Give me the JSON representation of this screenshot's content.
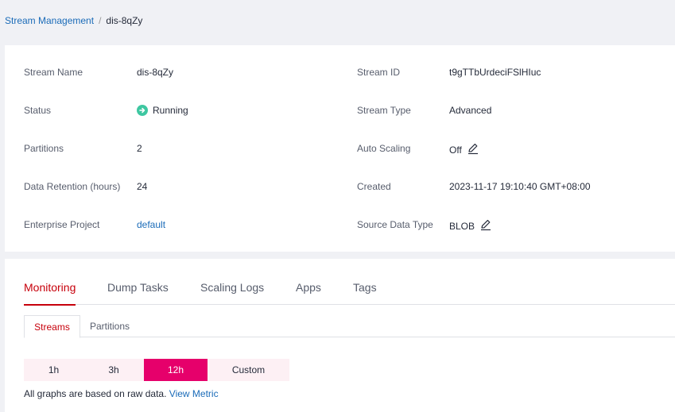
{
  "breadcrumb": {
    "parent": "Stream Management",
    "separator": "/",
    "current": "dis-8qZy"
  },
  "info": {
    "stream_name_label": "Stream Name",
    "stream_name_value": "dis-8qZy",
    "stream_id_label": "Stream ID",
    "stream_id_value": "t9gTTbUrdeciFSlHIuc",
    "status_label": "Status",
    "status_value": "Running",
    "stream_type_label": "Stream Type",
    "stream_type_value": "Advanced",
    "partitions_label": "Partitions",
    "partitions_value": "2",
    "auto_scaling_label": "Auto Scaling",
    "auto_scaling_value": "Off",
    "retention_label": "Data Retention (hours)",
    "retention_value": "24",
    "created_label": "Created",
    "created_value": "2023-11-17 19:10:40 GMT+08:00",
    "enterprise_label": "Enterprise Project",
    "enterprise_value": "default",
    "source_type_label": "Source Data Type",
    "source_type_value": "BLOB"
  },
  "tabs": [
    "Monitoring",
    "Dump Tasks",
    "Scaling Logs",
    "Apps",
    "Tags"
  ],
  "subtabs": [
    "Streams",
    "Partitions"
  ],
  "ranges": [
    "1h",
    "3h",
    "12h",
    "Custom"
  ],
  "active_range": "12h",
  "note": {
    "text": "All graphs are based on raw data.",
    "link": "View Metric"
  },
  "colors": {
    "accent": "#c7000b",
    "range_active": "#e6006b",
    "range_bg": "#fdf0f4",
    "link": "#1a6bb8",
    "running": "#3ec7a1"
  },
  "icons": {
    "status": "running-arrow-icon",
    "edit": "edit-pencil-icon"
  }
}
